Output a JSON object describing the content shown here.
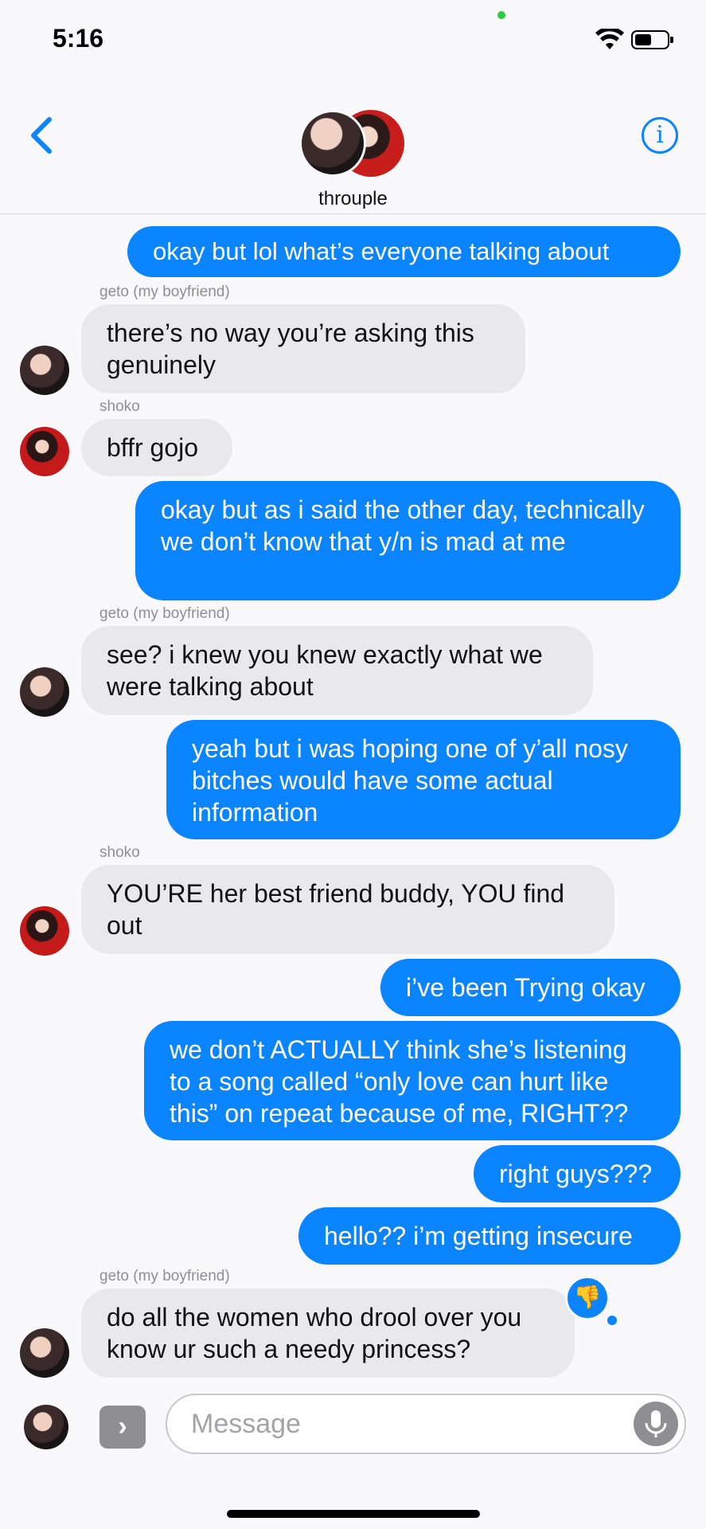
{
  "status": {
    "time": "5:16"
  },
  "header": {
    "group_name": "throuple",
    "info_glyph": "i"
  },
  "colors": {
    "accent": "#0a84ff",
    "incoming": "#e9e9eb",
    "outgoing_text": "#ffffff"
  },
  "messages": [
    {
      "from": "me",
      "text": "okay but lol what’s everyone talking about"
    },
    {
      "from": "geto",
      "sender": "geto (my boyfriend)",
      "text": "there’s no way you’re asking this genuinely"
    },
    {
      "from": "shoko",
      "sender": "shoko",
      "text": "bffr gojo"
    },
    {
      "from": "me",
      "text": "okay but as i said the other day, technically we don’t know that y/n is mad at me"
    },
    {
      "from": "geto",
      "sender": "geto (my boyfriend)",
      "text": "see? i knew you knew exactly what we were talking about"
    },
    {
      "from": "me",
      "text": "yeah but i was hoping one of y’all nosy bitches would have some actual information"
    },
    {
      "from": "shoko",
      "sender": "shoko",
      "text": "YOU’RE her best friend buddy, YOU find out"
    },
    {
      "from": "me",
      "text": "i’ve been Trying okay"
    },
    {
      "from": "me",
      "text": "we don’t ACTUALLY think she’s listening to a song called “only love can hurt like this” on repeat because of me, RIGHT??"
    },
    {
      "from": "me",
      "text": "right guys???"
    },
    {
      "from": "me",
      "text": "hello?? i’m getting insecure"
    },
    {
      "from": "geto",
      "sender": "geto (my boyfriend)",
      "text": "do all the women who drool over you know ur such a needy princess?",
      "tapback": "thumbs-down-icon"
    }
  ],
  "composer": {
    "placeholder": "Message"
  }
}
